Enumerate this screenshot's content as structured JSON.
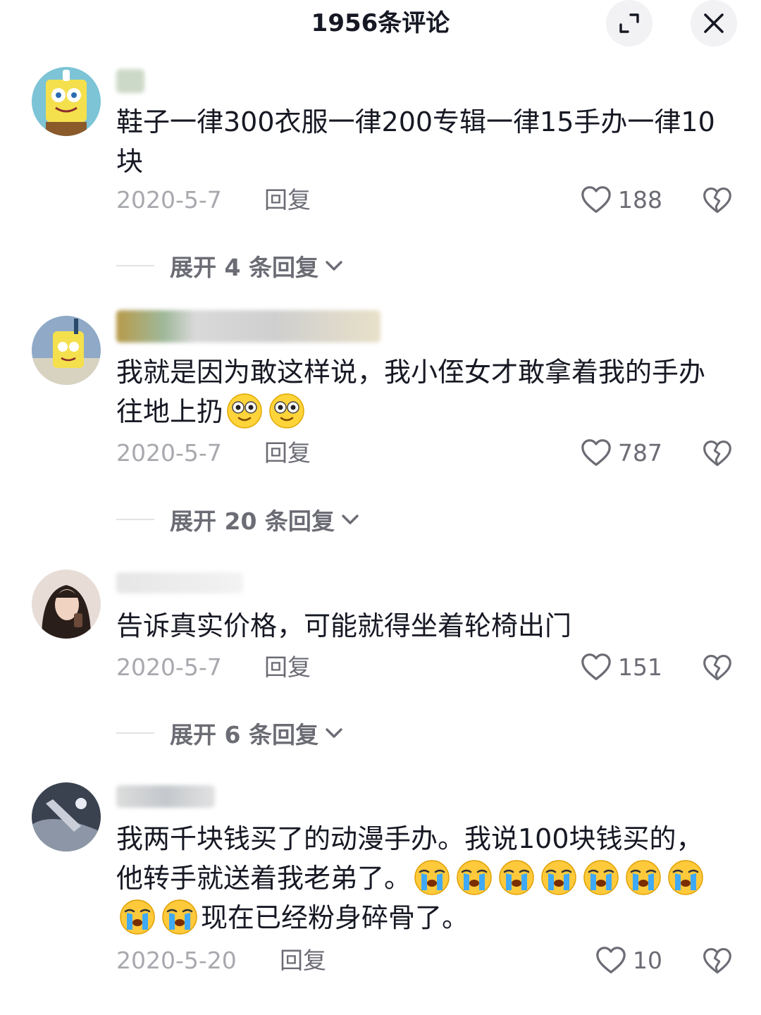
{
  "header": {
    "title": "1956条评论"
  },
  "comments": [
    {
      "text": "鞋子一律300衣服一律200专辑一律15手办一律10块",
      "date": "2020-5-7",
      "reply": "回复",
      "likes": "188",
      "expand": "展开 4 条回复"
    },
    {
      "text": "我就是因为敢这样说，我小侄女才敢拿着我的手办往地上扔",
      "date": "2020-5-7",
      "reply": "回复",
      "likes": "787",
      "expand": "展开 20 条回复"
    },
    {
      "text": "告诉真实价格，可能就得坐着轮椅出门",
      "date": "2020-5-7",
      "reply": "回复",
      "likes": "151",
      "expand": "展开 6 条回复"
    },
    {
      "text_a": "我两千块钱买了的动漫手办。我说100块钱买的，他转手就送着我老弟了。",
      "text_b": "现在已经粉身碎骨了。",
      "date": "2020-5-20",
      "reply": "回复",
      "likes": "10"
    }
  ],
  "icons": {
    "expand": "expand-icon",
    "close": "close-icon",
    "like": "heart-outline-icon",
    "dislike": "broken-heart-icon",
    "chevron": "chevron-down-icon",
    "emoji_1": "smile-emoji",
    "emoji_2": "cry-emoji"
  },
  "colors": {
    "text": "#161823",
    "muted": "#a8a9ae",
    "secondary": "#6b6c74"
  }
}
